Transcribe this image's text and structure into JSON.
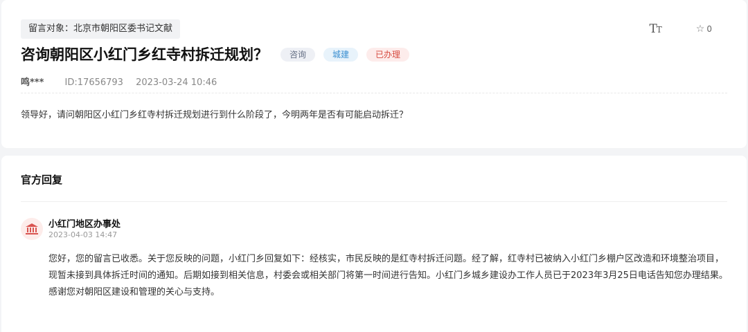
{
  "question": {
    "target_label": "留言对象：北京市朝阳区委书记文献",
    "title": "咨询朝阳区小红门乡红寺村拆迁规划？",
    "tags": [
      "咨询",
      "城建",
      "已办理"
    ],
    "author": "鸣***",
    "id_text": "ID:17656793",
    "datetime": "2023-03-24 10:46",
    "body": "领导好，请问朝阳区小红门乡红寺村拆迁规划进行到什么阶段了，今明两年是否有可能启动拆迁？"
  },
  "toolbar": {
    "font_size_glyph_big": "T",
    "font_size_glyph_small": "T",
    "favorite_count": "0",
    "font_icon": "font-size-icon",
    "star_icon": "star-icon"
  },
  "reply": {
    "heading": "官方回复",
    "org_name": "小红门地区办事处",
    "org_time": "2023-04-03 14:47",
    "org_icon": "government-building-icon",
    "body": "您好，您的留言已收悉。关于您反映的问题，小红门乡回复如下：经核实，市民反映的是红寺村拆迁问题。经了解，红寺村已被纳入小红门乡棚户区改造和环境整治项目，现暂未接到具体拆迁时间的通知。后期如接到相关信息，村委会或相关部门将第一时间进行告知。小红门乡城乡建设办工作人员已于2023年3月25日电话告知您办理结果。感谢您对朝阳区建设和管理的关心与支持。"
  },
  "colors": {
    "background": "#f3f4f6",
    "card": "#ffffff",
    "tag_consult_text": "#667085",
    "tag_urban_text": "#3a8fd1",
    "tag_done_text": "#d64a3f",
    "avatar_bg": "#fdecea",
    "avatar_icon": "#d9534f"
  }
}
